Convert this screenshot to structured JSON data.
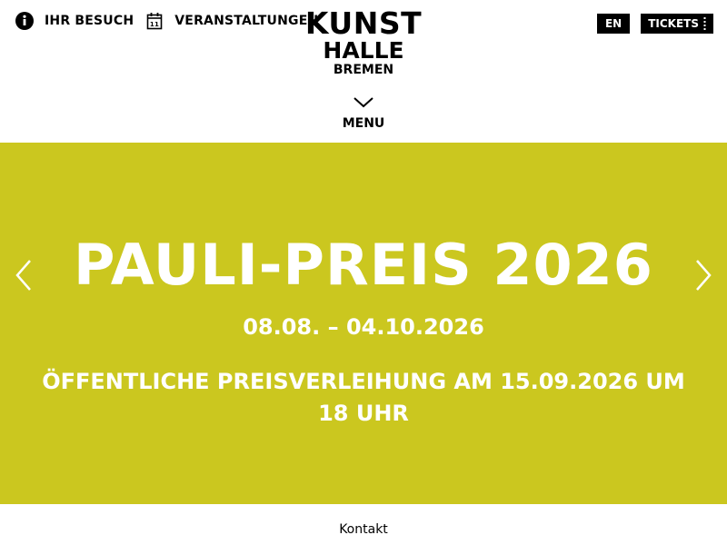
{
  "colors": {
    "hero_background": "#cbc71f",
    "text_dark": "#000000",
    "text_light": "#ffffff"
  },
  "header": {
    "nav_left": [
      {
        "label": "IHR BESUCH",
        "icon": "info-icon"
      },
      {
        "label": "VERANSTALTUNGEN",
        "icon": "calendar-icon",
        "icon_text": "11"
      }
    ],
    "logo": {
      "line1": "KUNST",
      "line2": "HALLE",
      "line3": "BREMEN"
    },
    "menu": {
      "label": "MENU",
      "icon": "chevron-down-icon"
    },
    "language_button": "EN",
    "tickets_button": "TICKETS"
  },
  "hero": {
    "title": "PAULI-PREIS 2026",
    "dates": "08.08. – 04.10.2026",
    "event_text": "ÖFFENTLICHE PREISVERLEIHUNG AM 15.09.2026 UM 18 UHR",
    "prev_icon": "chevron-left-icon",
    "next_icon": "chevron-right-icon"
  },
  "footer": {
    "link": "Kontakt"
  }
}
